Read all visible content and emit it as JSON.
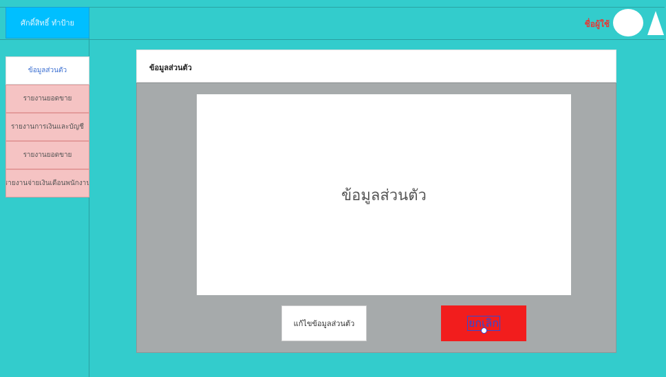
{
  "header": {
    "brand": "ศักดิ์สิทธิ์ ทำป้าย",
    "username": "ชื่อผู้ใช้"
  },
  "sidebar": {
    "items": [
      {
        "label": "ข้อมูลส่วนตัว",
        "active": true
      },
      {
        "label": "รายงานยอดขาย",
        "active": false
      },
      {
        "label": "รายงานการเงินและบัญชี",
        "active": false
      },
      {
        "label": "รายงานยอดขาย",
        "active": false
      },
      {
        "label": "รายงานจ่ายเงินเดือนพนักงาน",
        "active": false
      }
    ]
  },
  "panel": {
    "title": "ข้อมูลส่วนตัว",
    "content_label": "ข้อมูลส่วนตัว",
    "edit_button": "แก้ไขข้อมูลส่วนตัว",
    "cancel_button": "ยกเลิก"
  },
  "colors": {
    "background": "#33cccc",
    "brand": "#00bfff",
    "menu_item": "#f5c3c3",
    "panel_body": "#a6aaab",
    "cancel": "#f21d1d",
    "username": "#e53935"
  },
  "icons": {
    "avatar": "avatar-icon",
    "dropdown": "triangle-up-icon"
  }
}
